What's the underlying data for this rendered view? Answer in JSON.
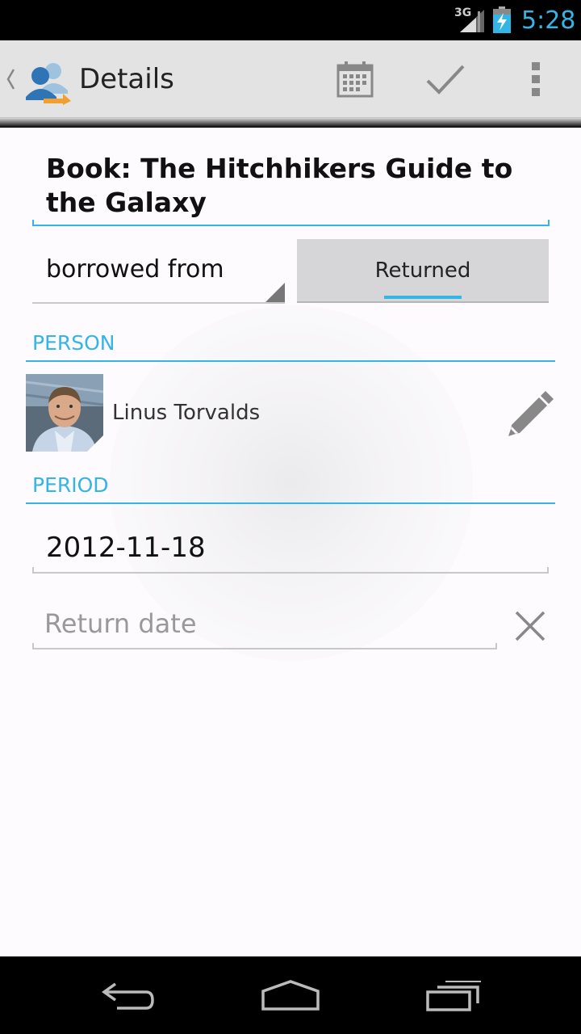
{
  "status_bar": {
    "network": "3G",
    "time": "5:28"
  },
  "action_bar": {
    "title": "Details",
    "actions": [
      "calendar-icon",
      "check-icon",
      "overflow-menu-icon"
    ]
  },
  "form": {
    "title": "Book: The Hitchhikers Guide to the Galaxy",
    "direction_spinner": "borrowed from",
    "returned_button": "Returned",
    "person_section": "PERSON",
    "person_name": "Linus Torvalds",
    "period_section": "PERIOD",
    "start_date": "2012-11-18",
    "return_date_placeholder": "Return date"
  },
  "nav_bar": {
    "buttons": [
      "back-icon",
      "home-icon",
      "recents-icon"
    ]
  },
  "colors": {
    "accent": "#33b5e5",
    "background": "#fdfbfd",
    "action_bar": "#e3e3e3"
  }
}
